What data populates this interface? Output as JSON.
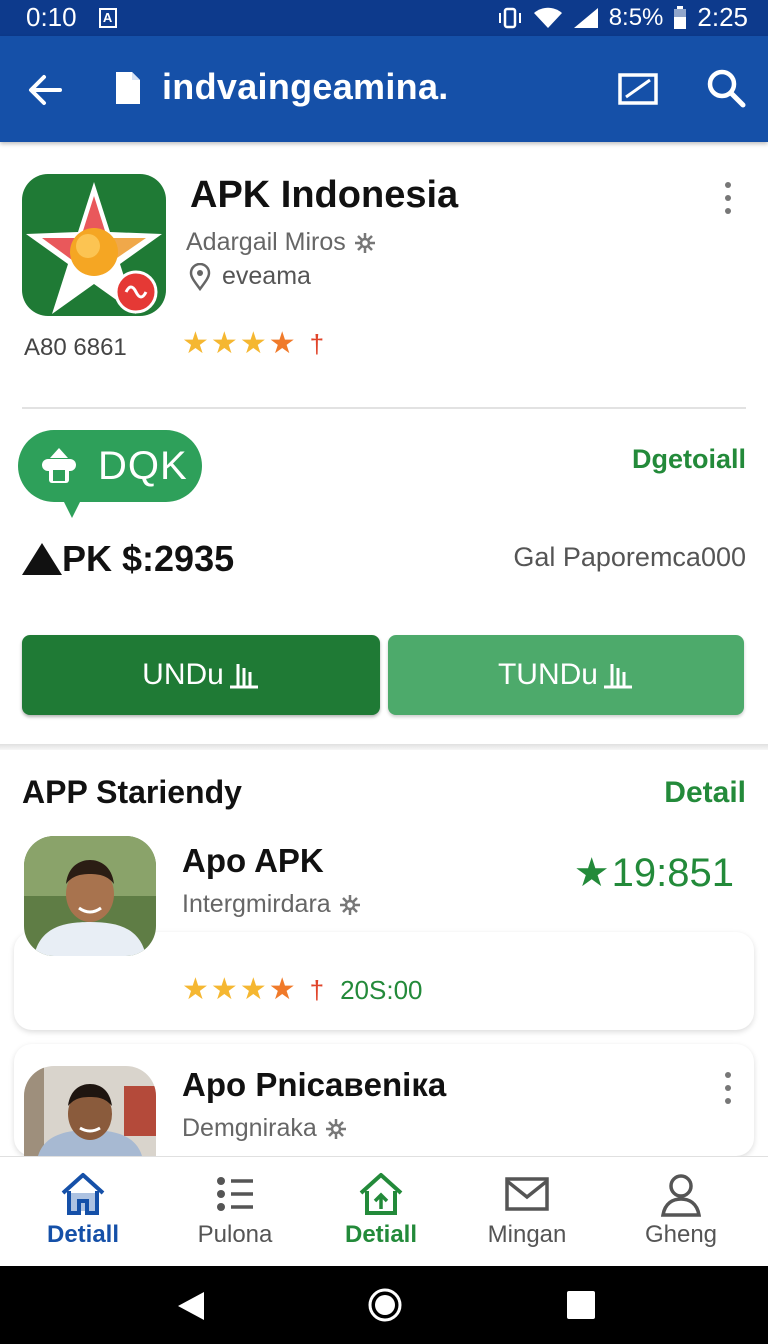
{
  "status_bar": {
    "left_time": "0:10",
    "left_icon": "A",
    "battery_text": "8:5%",
    "time": "2:25"
  },
  "app_bar": {
    "title": "indvaingeamina.",
    "icons": [
      "back-arrow-icon",
      "document-icon",
      "edit-icon",
      "search-icon"
    ]
  },
  "app": {
    "name": "APK Indonesia",
    "developer": "Adargail Miros",
    "location": "eveama",
    "id": "A80 6861",
    "rating_dagger": "†"
  },
  "download": {
    "badge_label": "DQK",
    "detail_link": "Dgetoiall",
    "price": "PK $:2935",
    "publisher": "Gal Paporemca000",
    "button_primary": "UNDu",
    "button_secondary": "TUNDu",
    "colors": {
      "primary": "#1f7a35",
      "secondary": "#4daa6b",
      "badge": "#2ea05a"
    }
  },
  "section": {
    "title": "APP Stariendy",
    "detail_link": "Detail"
  },
  "items": [
    {
      "name": "Apo APK",
      "subtitle": "Intergmirdara",
      "score": "19:851",
      "rating_dagger": "†",
      "count": "20S:00"
    },
    {
      "name": "Apo Pnicaвeniка",
      "subtitle": "Demgniraka"
    }
  ],
  "bottom_nav": [
    {
      "label": "Detiall",
      "icon": "home-icon",
      "active": true
    },
    {
      "label": "Pulona",
      "icon": "list-icon",
      "active": false
    },
    {
      "label": "Detiall",
      "icon": "house-up-icon",
      "active": true
    },
    {
      "label": "Mingan",
      "icon": "mail-icon",
      "active": false
    },
    {
      "label": "Gheng",
      "icon": "person-icon",
      "active": false
    }
  ]
}
